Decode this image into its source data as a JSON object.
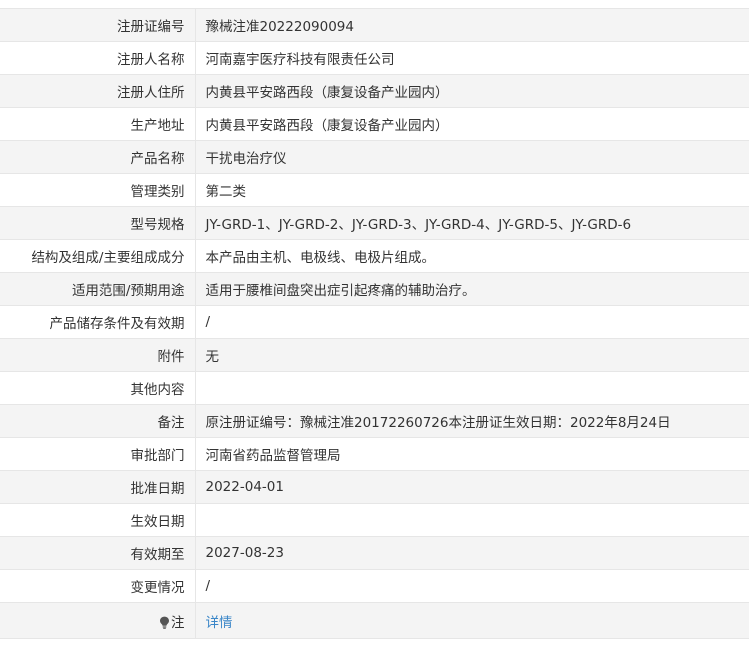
{
  "records": {
    "reg_no": {
      "label": "注册证编号",
      "value": "豫械注准20222090094"
    },
    "registrant": {
      "label": "注册人名称",
      "value": "河南嘉宇医疗科技有限责任公司"
    },
    "address": {
      "label": "注册人住所",
      "value": "内黄县平安路西段（康复设备产业园内）"
    },
    "production_address": {
      "label": "生产地址",
      "value": "内黄县平安路西段（康复设备产业园内）"
    },
    "product_name": {
      "label": "产品名称",
      "value": "干扰电治疗仪"
    },
    "category": {
      "label": "管理类别",
      "value": "第二类"
    },
    "model": {
      "label": "型号规格",
      "value": "JY-GRD-1、JY-GRD-2、JY-GRD-3、JY-GRD-4、JY-GRD-5、JY-GRD-6"
    },
    "composition": {
      "label": "结构及组成/主要组成成分",
      "value": "本产品由主机、电极线、电极片组成。"
    },
    "intended_use": {
      "label": "适用范围/预期用途",
      "value": "适用于腰椎间盘突出症引起疼痛的辅助治疗。"
    },
    "storage": {
      "label": "产品储存条件及有效期",
      "value": "/"
    },
    "attachment": {
      "label": "附件",
      "value": "无"
    },
    "other": {
      "label": "其他内容",
      "value": ""
    },
    "remarks": {
      "label": "备注",
      "value": "原注册证编号：豫械注准20172260726本注册证生效日期：2022年8月24日"
    },
    "department": {
      "label": "审批部门",
      "value": "河南省药品监督管理局"
    },
    "approval_date": {
      "label": "批准日期",
      "value": "2022-04-01"
    },
    "effective_date": {
      "label": "生效日期",
      "value": ""
    },
    "valid_until": {
      "label": "有效期至",
      "value": "2027-08-23"
    },
    "changes": {
      "label": "变更情况",
      "value": "/"
    },
    "note": {
      "label": "注",
      "icon": "lightbulb-icon",
      "link_text": "详情"
    }
  },
  "colors": {
    "border": "#e6e6e6",
    "shaded_row": "#f4f4f4",
    "text": "#333333",
    "link": "#3a86c8"
  }
}
